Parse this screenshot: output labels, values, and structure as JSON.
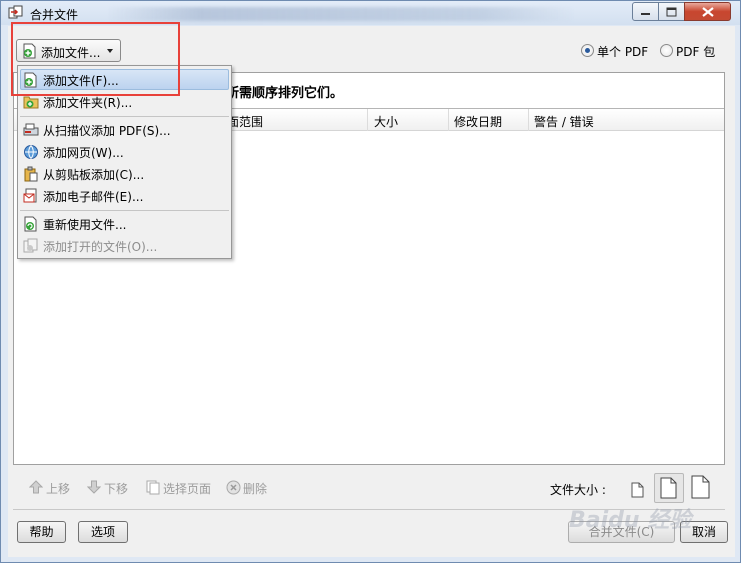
{
  "window": {
    "title": "合并文件",
    "icon": "combine-files-icon"
  },
  "toolbar": {
    "add_files_label": "添加文件...",
    "output_options": [
      {
        "label": "单个 PDF",
        "selected": true
      },
      {
        "label": "PDF 包",
        "selected": false
      }
    ]
  },
  "main": {
    "instruction": "所需顺序排列它们。",
    "columns": [
      "面范围",
      "大小",
      "修改日期",
      "警告 / 错误"
    ]
  },
  "add_menu": {
    "items": [
      {
        "label": "添加文件(F)...",
        "icon": "add-file-icon",
        "highlighted": true,
        "enabled": true
      },
      {
        "label": "添加文件夹(R)...",
        "icon": "add-folder-icon",
        "enabled": true
      },
      {
        "label": "从扫描仪添加 PDF(S)...",
        "icon": "scanner-icon",
        "enabled": true
      },
      {
        "label": "添加网页(W)...",
        "icon": "web-page-icon",
        "enabled": true
      },
      {
        "label": "从剪贴板添加(C)...",
        "icon": "clipboard-icon",
        "enabled": true
      },
      {
        "label": "添加电子邮件(E)...",
        "icon": "email-icon",
        "enabled": true
      },
      {
        "label": "重新使用文件...",
        "icon": "reuse-files-icon",
        "enabled": true
      },
      {
        "label": "添加打开的文件(O)...",
        "icon": "open-files-icon",
        "enabled": false
      }
    ]
  },
  "bottom_tools": {
    "move_up": "上移",
    "move_down": "下移",
    "choose_pages": "选择页面",
    "remove": "删除",
    "file_size_label": "文件大小 :"
  },
  "footer": {
    "help": "帮助",
    "options": "选项",
    "combine": "合并文件(C)",
    "cancel": "取消"
  },
  "watermark": "Baidu 经验",
  "colors": {
    "highlight": "#bcd3ef",
    "callout": "#e8413a",
    "close_button": "#c8462f"
  }
}
